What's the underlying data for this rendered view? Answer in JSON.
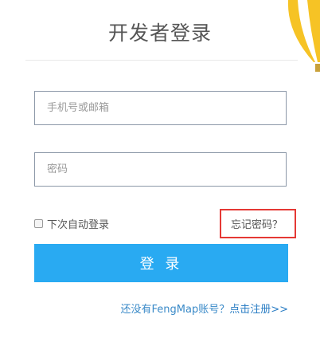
{
  "header": {
    "title": "开发者登录"
  },
  "form": {
    "phone_placeholder": "手机号或邮箱",
    "password_placeholder": "密码",
    "remember_label": "下次自动登录",
    "remember_checked": false,
    "forgot_label": "忘记密码？",
    "login_label": "登 录"
  },
  "footer": {
    "register_prompt": "还没有FengMap账号？",
    "register_link": "点击注册>>"
  },
  "colors": {
    "primary": "#29aaf2",
    "highlight_box": "#e53935",
    "link": "#2a7dc4"
  }
}
